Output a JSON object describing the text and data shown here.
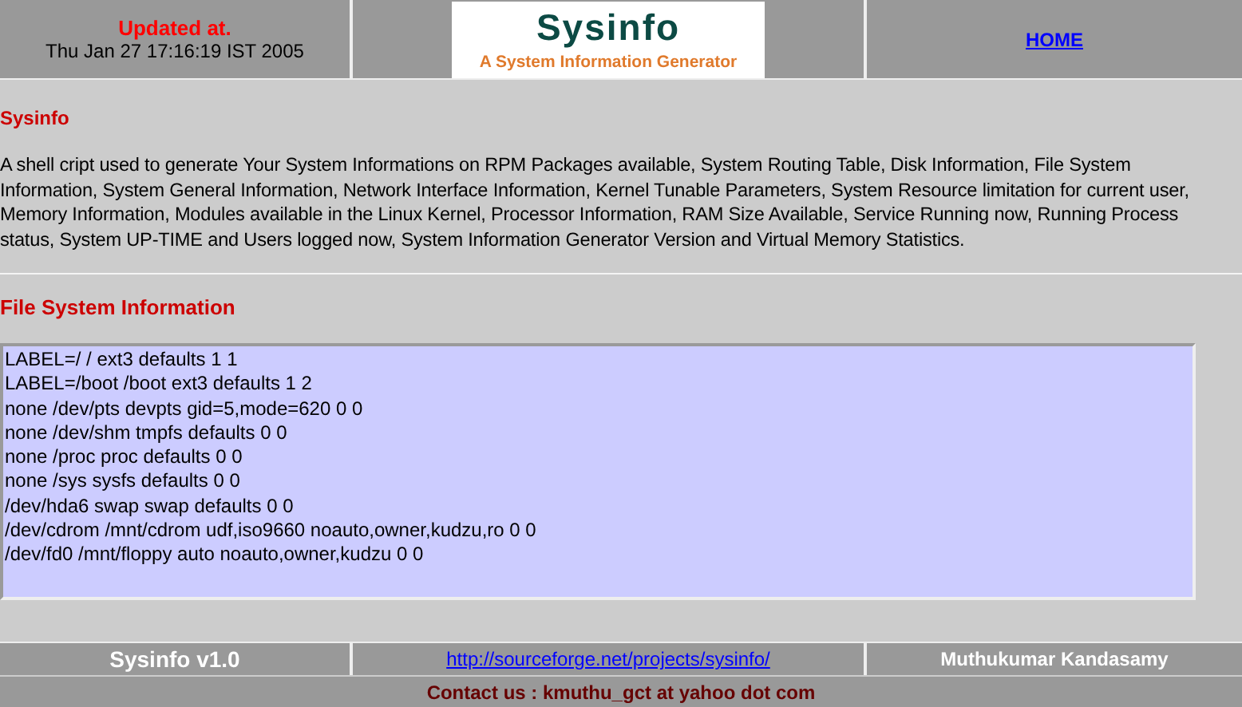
{
  "header": {
    "updated_label": "Updated at.",
    "updated_time": "Thu Jan 27 17:16:19 IST 2005",
    "logo_title": "Sysinfo",
    "logo_subtitle": "A System Information Generator",
    "home_link": "HOME"
  },
  "intro": {
    "title": "Sysinfo",
    "text": "A shell cript used to generate Your System Informations on RPM Packages available, System Routing Table, Disk Information, File System Information, System General Information, Network Interface Information, Kernel Tunable Parameters, System Resource limitation for current user, Memory Information, Modules available in the Linux Kernel, Processor Information, RAM Size Available, Service Running now, Running Process status, System UP-TIME and Users logged now, System Information Generator Version and Virtual Memory Statistics."
  },
  "section": {
    "title": "File System Information",
    "lines": [
      "LABEL=/ / ext3 defaults 1 1",
      "LABEL=/boot /boot ext3 defaults 1 2",
      "none /dev/pts devpts gid=5,mode=620 0 0",
      "none /dev/shm tmpfs defaults 0 0",
      "none /proc proc defaults 0 0",
      "none /sys sysfs defaults 0 0",
      "/dev/hda6 swap swap defaults 0 0",
      "/dev/cdrom /mnt/cdrom udf,iso9660 noauto,owner,kudzu,ro 0 0",
      "/dev/fd0 /mnt/floppy auto noauto,owner,kudzu 0 0"
    ]
  },
  "footer": {
    "version": "Sysinfo v1.0",
    "project_link": "http://sourceforge.net/projects/sysinfo/",
    "author": "Muthukumar Kandasamy",
    "contact": "Contact us : kmuthu_gct at yahoo dot com"
  }
}
